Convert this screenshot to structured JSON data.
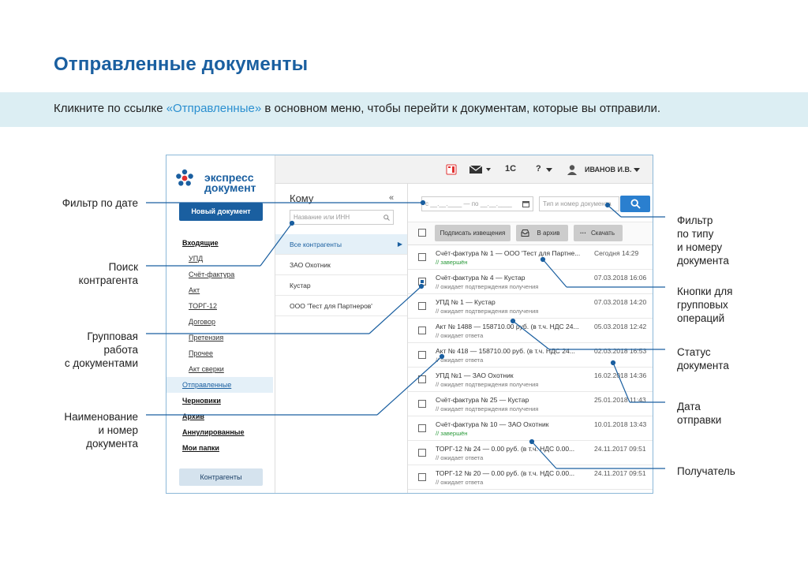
{
  "page": {
    "title": "Отправленные документы",
    "banner_before": "Кликните по ссылке ",
    "banner_link": "«Отправленные»",
    "banner_after": " в основном меню, чтобы перейти к документам, которые вы отправили."
  },
  "app": {
    "logo_line1": "экспресс",
    "logo_line2": "документ",
    "new_doc_button": "Новый документ",
    "nav": [
      {
        "label": "Входящие",
        "style": "bold"
      },
      {
        "label": "УПД",
        "style": "sub"
      },
      {
        "label": "Счёт-фактура",
        "style": "sub"
      },
      {
        "label": "Акт",
        "style": "sub"
      },
      {
        "label": "ТОРГ-12",
        "style": "sub"
      },
      {
        "label": "Договор",
        "style": "sub"
      },
      {
        "label": "Претензия",
        "style": "sub"
      },
      {
        "label": "Прочее",
        "style": "sub"
      },
      {
        "label": "Акт сверки",
        "style": "sub"
      },
      {
        "label": "Отправленные",
        "style": "active"
      },
      {
        "label": "Черновики",
        "style": "bold"
      },
      {
        "label": "Архив",
        "style": "bold"
      },
      {
        "label": "Аннулированные",
        "style": "bold"
      },
      {
        "label": "Мои папки",
        "style": "bold"
      }
    ],
    "contractors_button": "Контрагенты",
    "topbar": {
      "onec": "1С",
      "help": "?",
      "user": "ИВАНОВ И.В."
    },
    "kontr": {
      "heading": "Кому",
      "collapse": "«",
      "search_placeholder": "Название или ИНН",
      "items": [
        {
          "label": "Все контрагенты",
          "active": true
        },
        {
          "label": "ЗАО Охотник",
          "active": false
        },
        {
          "label": "Кустар",
          "active": false
        },
        {
          "label": "ООО 'Тест для Партнеров'",
          "active": false
        }
      ]
    },
    "docs": {
      "date_filter": "с __.__.____ — по __.__.____",
      "type_filter_placeholder": "Тип и номер документа",
      "btn_sign": "Подписать извещения",
      "btn_archive": "В архив",
      "btn_download": "Скачать",
      "rows": [
        {
          "title": "Счёт-фактура № 1  —  ООО 'Тест для Партне...",
          "status": "// завершён",
          "done": true,
          "date": "Сегодня 14:29"
        },
        {
          "title": "Счёт-фактура № 4  —  Кустар",
          "status": "// ожидает подтверждения получения",
          "done": false,
          "date": "07.03.2018 16:06"
        },
        {
          "title": "УПД № 1  —  Кустар",
          "status": "// ожидает подтверждения получения",
          "done": false,
          "date": "07.03.2018 14:20"
        },
        {
          "title": "Акт № 1488  —  158710.00 руб. (в т.ч. НДС 24...",
          "status": "// ожидает ответа",
          "done": false,
          "date": "05.03.2018 12:42"
        },
        {
          "title": "Акт №  418  —  158710.00 руб. (в т.ч. НДС 24...",
          "status": "// ожидает ответа",
          "done": false,
          "date": "02.03.2018 16:53"
        },
        {
          "title": "УПД №1  —  ЗАО Охотник",
          "status": "// ожидает подтверждения получения",
          "done": false,
          "date": "16.02.2018 14:36"
        },
        {
          "title": "Счёт-фактура № 25  —  Кустар",
          "status": "// ожидает подтверждения получения",
          "done": false,
          "date": "25.01.2018 11:43"
        },
        {
          "title": "Счёт-фактура № 10  —  ЗАО Охотник",
          "status": "// завершён",
          "done": true,
          "date": "10.01.2018 13:43"
        },
        {
          "title": "ТОРГ-12 № 24  —  0.00 руб. (в т.ч. НДС 0.00...",
          "status": "// ожидает ответа",
          "done": false,
          "date": "24.11.2017 09:51"
        },
        {
          "title": "ТОРГ-12 № 20  —  0.00 руб. (в т.ч. НДС 0.00...",
          "status": "// ожидает ответа",
          "done": false,
          "date": "24.11.2017 09:51"
        }
      ]
    }
  },
  "callouts": {
    "date_filter": "Фильтр по дате",
    "contr_search_l1": "Поиск",
    "contr_search_l2": "контрагента",
    "group_l1": "Групповая",
    "group_l2": "работа",
    "group_l3": "с документами",
    "name_l1": "Наименование",
    "name_l2": "и номер",
    "name_l3": "документа",
    "type_filter_l1": "Фильтр",
    "type_filter_l2": "по типу",
    "type_filter_l3": "и номеру",
    "type_filter_l4": "документа",
    "group_btns_l1": "Кнопки для",
    "group_btns_l2": "групповых",
    "group_btns_l3": "операций",
    "status_l1": "Статус",
    "status_l2": "документа",
    "date_sent_l1": "Дата",
    "date_sent_l2": "отправки",
    "recipient": "Получатель"
  },
  "colors": {
    "brand": "#1a5fa0",
    "banner": "#dceef3",
    "link": "#2a8fd0",
    "status_done": "#2a9a3a"
  }
}
